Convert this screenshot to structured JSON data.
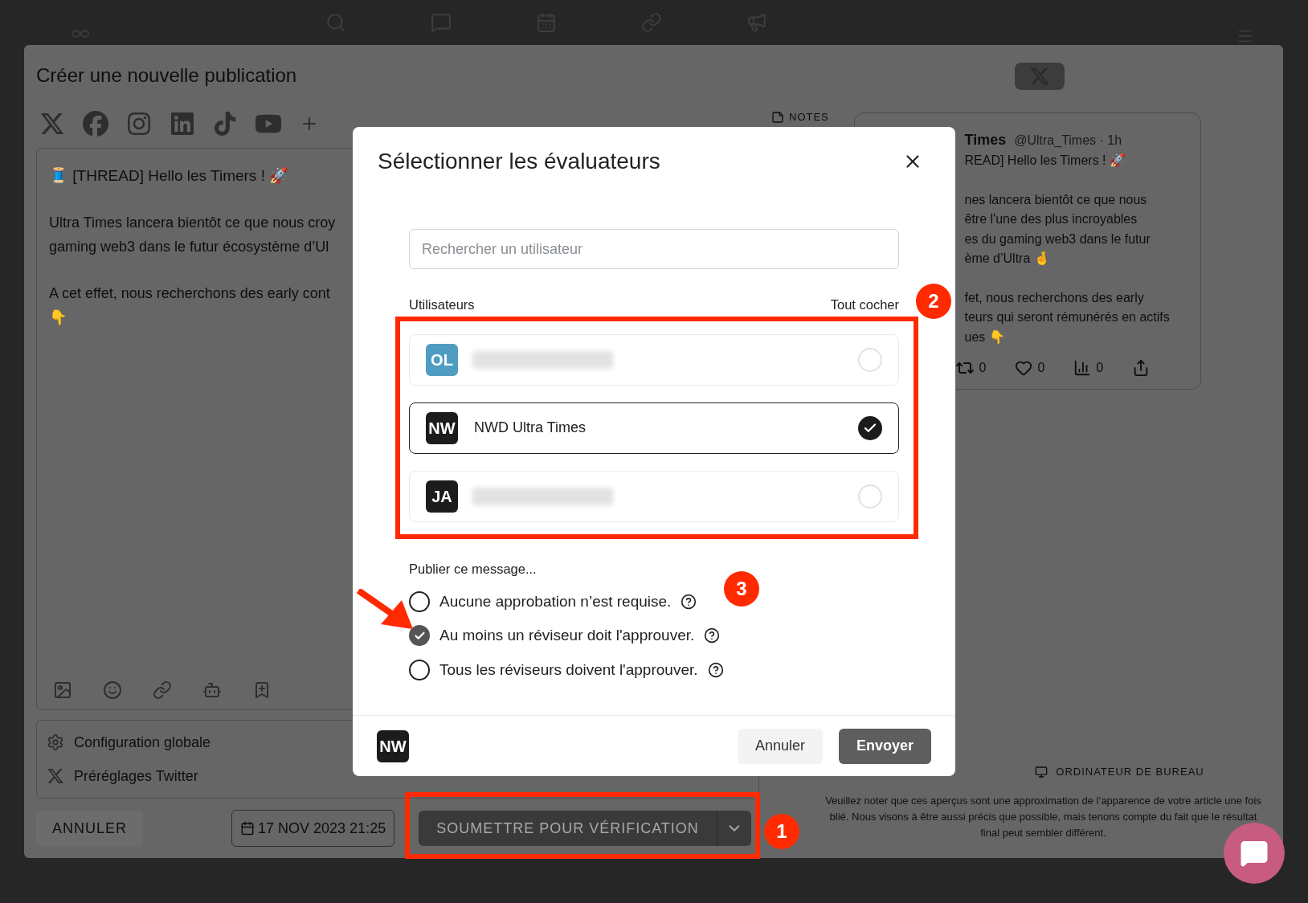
{
  "page": {
    "title": "Créer une nouvelle publication",
    "notes_label": "NOTES"
  },
  "editor": {
    "title": "🧵 [THREAD] Hello les Timers ! 🚀",
    "paragraphs": [
      [
        "Ultra Times lancera bientôt ce que nous croy",
        "gaming web3 dans le futur écosystème d’Ul"
      ],
      [
        "A cet effet, nous recherchons des early cont",
        "👇"
      ]
    ]
  },
  "settings": [
    {
      "kind": "gear",
      "label": "Configuration globale"
    },
    {
      "kind": "x",
      "label": "Préréglages Twitter"
    }
  ],
  "actions": {
    "cancel": "ANNULER",
    "date": "17 NOV 2023 21:25",
    "submit": "SOUMETTRE POUR VÉRIFICATION"
  },
  "preview": {
    "author": "Times",
    "handle": "@Ultra_Times · 1h",
    "paragraphs": [
      [
        "READ] Hello les Timers ! 🚀"
      ],
      [
        "nes lancera bientôt ce que nous",
        "être l'une des plus incroyables",
        "es du gaming web3 dans le futur",
        "ème d’Ultra 🤞"
      ],
      [
        "fet, nous recherchons des early",
        "teurs qui seront rémunérés en actifs",
        "ues 👇"
      ]
    ],
    "stats": [
      "0",
      "0",
      "0"
    ]
  },
  "device_tab": "ORDINATEUR DE BUREAU",
  "preview_note": [
    "Veuillez noter que ces aperçus sont une approximation de l’apparence de votre article une fois",
    "blié. Nous visons à être aussi précis que possible, mais tenons compte du fait que le résultat",
    "final peut sembler différent."
  ],
  "modal": {
    "title": "Sélectionner les évaluateurs",
    "search_placeholder": "Rechercher un utilisateur",
    "users_label": "Utilisateurs",
    "check_all": "Tout cocher",
    "users": [
      {
        "initials": "OL",
        "color": "#4f9cc3",
        "name_blurred": true,
        "selected": false
      },
      {
        "initials": "NW",
        "color": "#1c1c1c",
        "name": "NWD Ultra Times",
        "name_blurred": false,
        "selected": true
      },
      {
        "initials": "JA",
        "color": "#1c1c1c",
        "name_blurred": true,
        "selected": false
      }
    ],
    "publish_label": "Publier ce message...",
    "options": [
      {
        "label": "Aucune approbation n’est requise.",
        "selected": false
      },
      {
        "label": "Au moins un réviseur doit l'approuver.",
        "selected": true
      },
      {
        "label": "Tous les réviseurs doivent l'approuver.",
        "selected": false
      }
    ],
    "footer_initials": "NW",
    "cancel": "Annuler",
    "send": "Envoyer"
  },
  "annotations": [
    {
      "label": "1"
    },
    {
      "label": "2"
    },
    {
      "label": "3"
    }
  ]
}
